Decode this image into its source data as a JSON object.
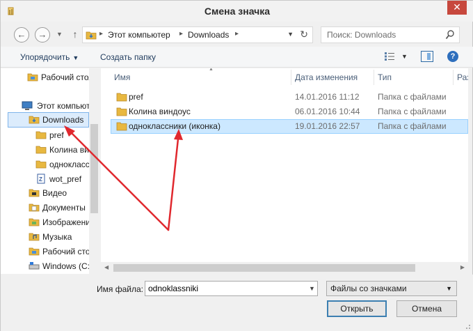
{
  "window": {
    "title": "Смена значка",
    "close_glyph": "✕"
  },
  "address": {
    "crumbs": [
      "Этот компьютер",
      "Downloads"
    ],
    "search_placeholder": "Поиск: Downloads"
  },
  "toolbar": {
    "organize_label": "Упорядочить",
    "new_folder_label": "Создать папку",
    "help_glyph": "?"
  },
  "nav_tree": [
    {
      "label": "Рабочий стол",
      "icon": "desktop-folder-icon"
    },
    {
      "label": "Этот компьютер",
      "icon": "computer-icon"
    },
    {
      "label": "Downloads",
      "icon": "downloads-folder-icon",
      "selected": true
    },
    {
      "label": "pref",
      "icon": "folder-icon"
    },
    {
      "label": "Колина виндоус",
      "icon": "folder-icon"
    },
    {
      "label": "одноклассники (иконка)",
      "icon": "folder-icon"
    },
    {
      "label": "wot_pref",
      "icon": "file-icon"
    },
    {
      "label": "Видео",
      "icon": "video-folder-icon"
    },
    {
      "label": "Документы",
      "icon": "documents-folder-icon"
    },
    {
      "label": "Изображения",
      "icon": "pictures-folder-icon"
    },
    {
      "label": "Музыка",
      "icon": "music-folder-icon"
    },
    {
      "label": "Рабочий стол",
      "icon": "desktop-folder-icon"
    },
    {
      "label": "Windows (C:)",
      "icon": "drive-icon"
    }
  ],
  "columns": {
    "name": "Имя",
    "date": "Дата изменения",
    "type": "Тип",
    "size": "Размер"
  },
  "files": [
    {
      "name": "pref",
      "date": "14.01.2016 11:12",
      "type": "Папка с файлами"
    },
    {
      "name": "Колина виндоус",
      "date": "06.01.2016 10:44",
      "type": "Папка с файлами"
    },
    {
      "name": "одноклассники (иконка)",
      "date": "19.01.2016 22:57",
      "type": "Папка с файлами",
      "selected": true
    }
  ],
  "bottom": {
    "filename_label": "Имя файла:",
    "filename_value": "odnoklassniki",
    "filter_value": "Файлы со значками",
    "open_label": "Открыть",
    "cancel_label": "Отмена"
  },
  "colors": {
    "accent": "#3c7fb1",
    "selection": "#cce8ff",
    "folder": "#e8b840",
    "annotation_arrow": "#e0282e",
    "close_button": "#c7483d"
  }
}
